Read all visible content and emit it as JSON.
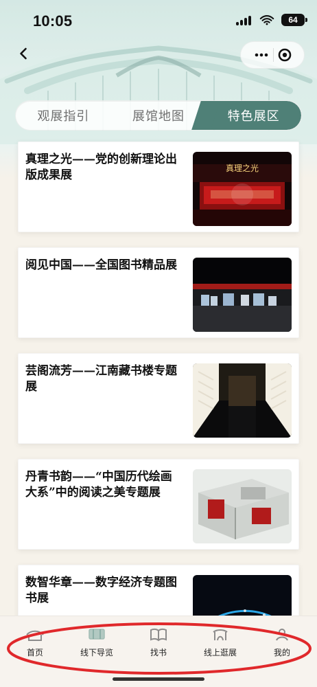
{
  "status_bar": {
    "time": "10:05",
    "battery": "64"
  },
  "top_bar": {
    "back_icon": "chevron-left-icon",
    "more_icon": "more-icon",
    "target_icon": "target-icon"
  },
  "tabs": [
    {
      "label": "观展指引",
      "active": false
    },
    {
      "label": "展馆地图",
      "active": false
    },
    {
      "label": "特色展区",
      "active": true
    }
  ],
  "exhibitions": [
    {
      "title": "真理之光——党的创新理论出版成果展",
      "thumb": "red-stage"
    },
    {
      "title": "阅见中国——全国图书精品展",
      "thumb": "hall-lights"
    },
    {
      "title": "芸阁流芳——江南藏书楼专题展",
      "thumb": "corridor"
    },
    {
      "title": "丹青书韵——“中国历代绘画大系”中的阅读之美专题展",
      "thumb": "booth-3d"
    },
    {
      "title": "数智华章——数字经济专题图书展",
      "thumb": "digital"
    }
  ],
  "bottom_nav": [
    {
      "label": "首页",
      "icon": "home-roof-icon"
    },
    {
      "label": "线下导览",
      "icon": "map-icon"
    },
    {
      "label": "找书",
      "icon": "book-icon"
    },
    {
      "label": "线上逛展",
      "icon": "gate-icon"
    },
    {
      "label": "我的",
      "icon": "user-icon"
    }
  ],
  "colors": {
    "accent": "#4f8077",
    "annotation": "#e0282b"
  }
}
